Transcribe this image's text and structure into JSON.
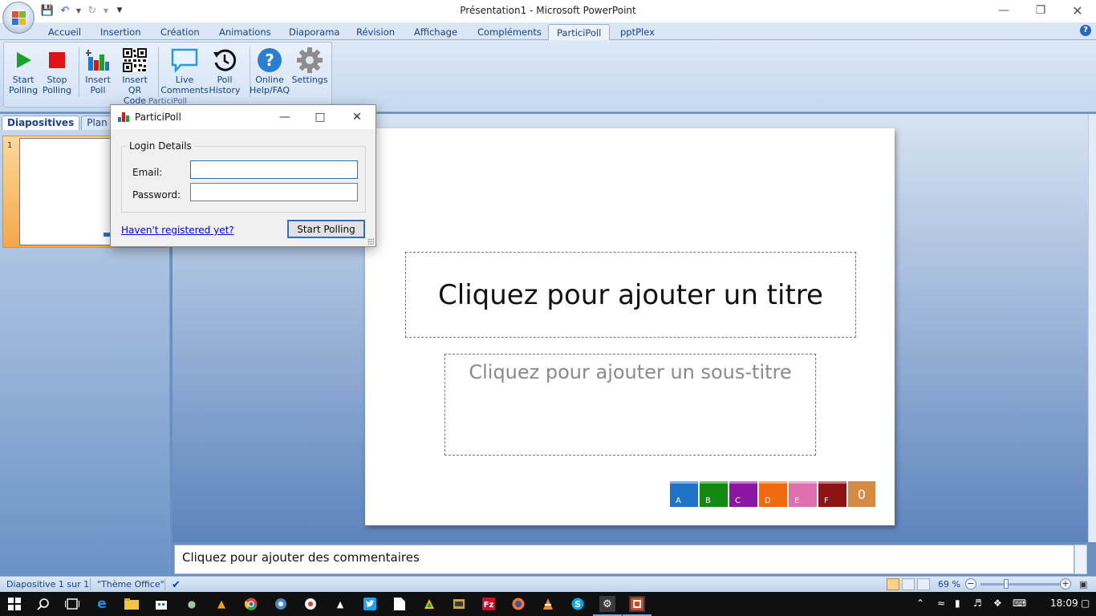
{
  "window": {
    "title": "Présentation1 - Microsoft PowerPoint",
    "controls": [
      "minimize",
      "restore",
      "close"
    ]
  },
  "ribbon_tabs": [
    {
      "label": "Accueil",
      "active": false
    },
    {
      "label": "Insertion",
      "active": false
    },
    {
      "label": "Création",
      "active": false
    },
    {
      "label": "Animations",
      "active": false
    },
    {
      "label": "Diaporama",
      "active": false
    },
    {
      "label": "Révision",
      "active": false
    },
    {
      "label": "Affichage",
      "active": false
    },
    {
      "label": "Compléments",
      "active": false
    },
    {
      "label": "ParticiPoll",
      "active": true
    },
    {
      "label": "pptPlex",
      "active": false
    }
  ],
  "ribbon": {
    "group_label": "ParticiPoll",
    "buttons": [
      {
        "label": "Start\nPolling",
        "icon": "play-icon"
      },
      {
        "label": "Stop\nPolling",
        "icon": "stop-icon"
      },
      {
        "label": "Insert\nPoll",
        "icon": "bar-chart-icon"
      },
      {
        "label": "Insert\nQR Code",
        "icon": "qr-code-icon"
      },
      {
        "label": "Live\nComments",
        "icon": "comment-icon"
      },
      {
        "label": "Poll\nHistory",
        "icon": "history-icon"
      },
      {
        "label": "Online\nHelp/FAQ",
        "icon": "help-icon"
      },
      {
        "label": "Settings",
        "icon": "gear-icon"
      }
    ]
  },
  "left_pane": {
    "tabs": [
      "Diapositives",
      "Plan"
    ],
    "close": "×",
    "slide_number": "1"
  },
  "slide": {
    "title_placeholder": "Cliquez pour ajouter un titre",
    "subtitle_placeholder": "Cliquez pour ajouter un sous-titre",
    "poll_options": [
      {
        "letter": "A",
        "color": "#1e73c8",
        "top": "#7ab0e6"
      },
      {
        "letter": "B",
        "color": "#128a12",
        "top": "#6fc06f"
      },
      {
        "letter": "C",
        "color": "#8b17a0",
        "top": "#c07ad0"
      },
      {
        "letter": "D",
        "color": "#f26a0f",
        "top": "#f7ab77"
      },
      {
        "letter": "E",
        "color": "#e06fb0",
        "top": "#eeadd3"
      },
      {
        "letter": "F",
        "color": "#8c1414",
        "top": "#c27a7a"
      }
    ],
    "poll_count": "0"
  },
  "notes": {
    "placeholder": "Cliquez pour ajouter des commentaires"
  },
  "status_bar": {
    "slide_info": "Diapositive 1 sur 1",
    "theme": "\"Thème Office\"",
    "zoom": "69 %",
    "zoom_minus": "−",
    "zoom_plus": "+"
  },
  "dialog": {
    "title": "ParticiPoll",
    "group_label": "Login Details",
    "email_label": "Email:",
    "email_value": "",
    "password_label": "Password:",
    "password_value": "",
    "register_link": "Haven't registered yet?",
    "start_button": "Start Polling"
  },
  "taskbar": {
    "time": "18:09"
  }
}
